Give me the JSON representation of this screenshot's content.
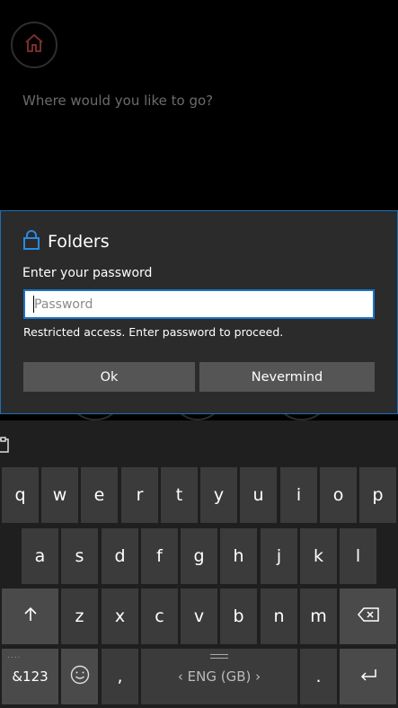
{
  "app": {
    "prompt": "Where would you like to go?"
  },
  "dialog": {
    "title": "Folders",
    "label": "Enter your password",
    "password_value": "",
    "password_placeholder": "Password",
    "message": "Restricted access. Enter password to proceed.",
    "ok_label": "Ok",
    "cancel_label": "Nevermind"
  },
  "colors": {
    "accent": "#1a73c6",
    "dialog_bg": "#2b2b2b",
    "button_bg": "#555555",
    "key_bg": "#3b3b3b",
    "home_icon": "#7a2c2c"
  },
  "keyboard": {
    "row1": [
      "q",
      "w",
      "e",
      "r",
      "t",
      "y",
      "u",
      "i",
      "o",
      "p"
    ],
    "row2": [
      "a",
      "s",
      "d",
      "f",
      "g",
      "h",
      "j",
      "k",
      "l"
    ],
    "row3": [
      "z",
      "x",
      "c",
      "v",
      "b",
      "n",
      "m"
    ],
    "numbers_label": "&123",
    "comma": ",",
    "period": ".",
    "space_label": "‹ ENG (GB) ›"
  }
}
